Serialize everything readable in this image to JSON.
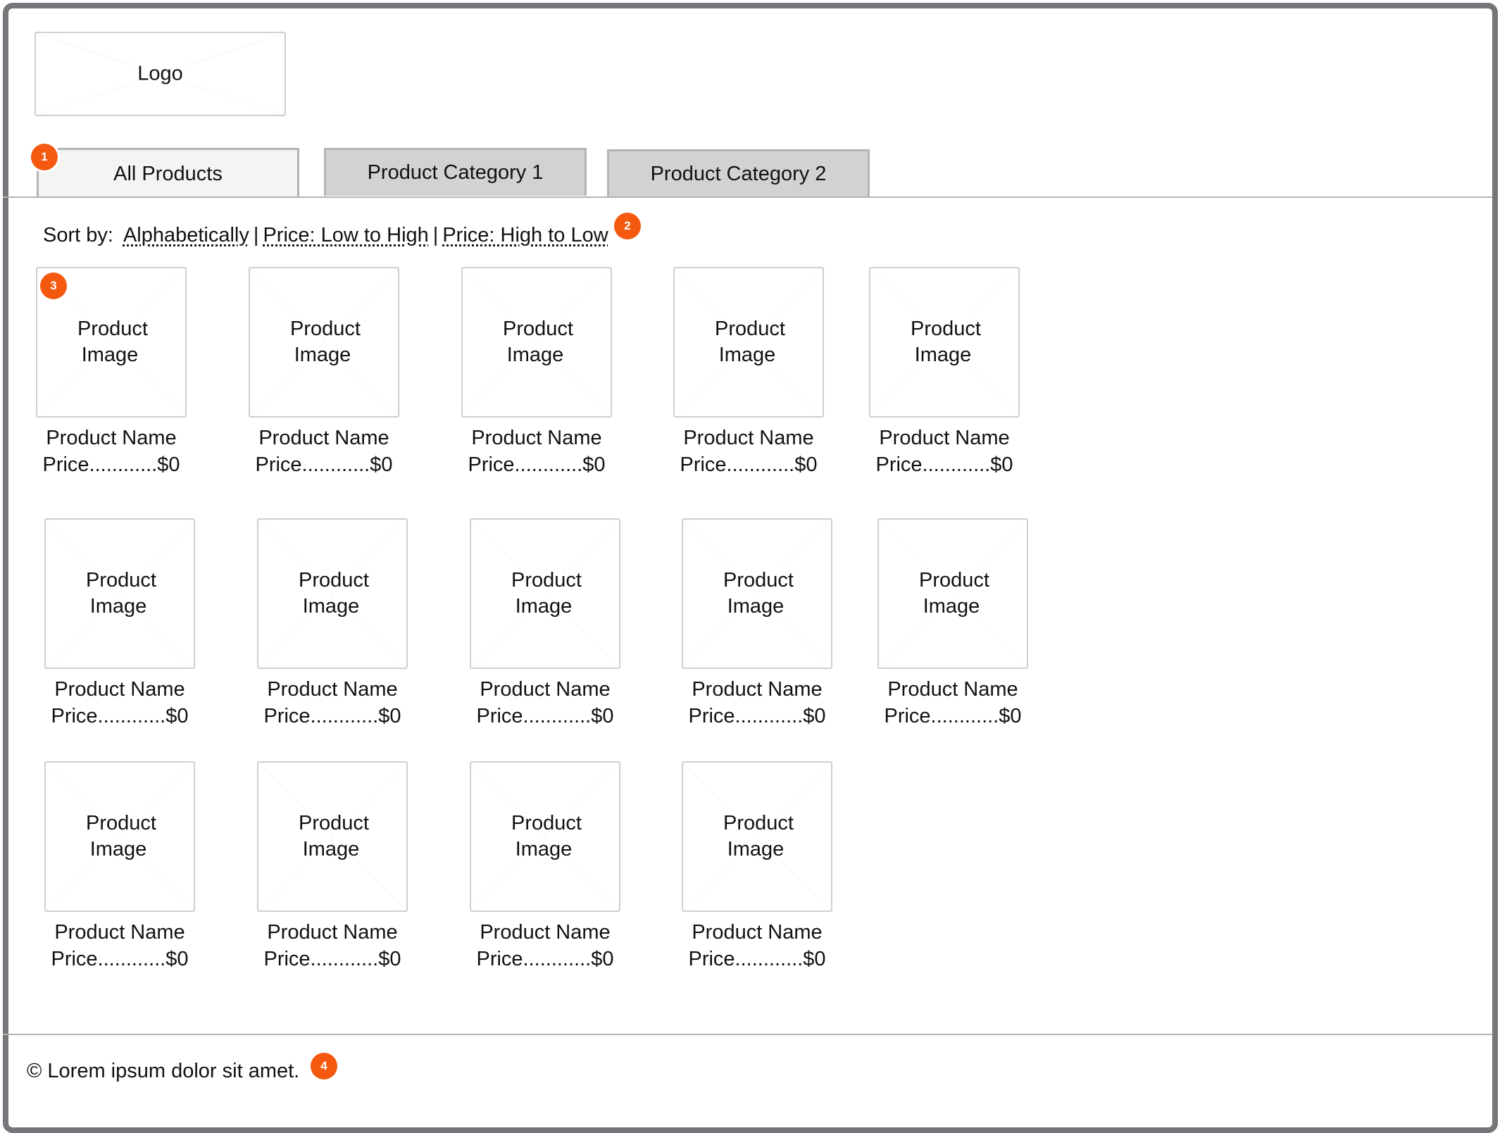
{
  "header": {
    "logo_label": "Logo"
  },
  "tabs": [
    {
      "label": "All Products",
      "active": true
    },
    {
      "label": "Product Category 1",
      "active": false
    },
    {
      "label": "Product Category 2",
      "active": false
    }
  ],
  "sort": {
    "label": "Sort by:",
    "options": [
      "Alphabetically",
      "Price: Low to High",
      "Price: High to Low"
    ],
    "separator": "|"
  },
  "products": [
    {
      "image_label_1": "Product",
      "image_label_2": "Image",
      "name": "Product Name",
      "price": "Price............$0"
    },
    {
      "image_label_1": "Product",
      "image_label_2": "Image",
      "name": "Product Name",
      "price": "Price............$0"
    },
    {
      "image_label_1": "Product",
      "image_label_2": "Image",
      "name": "Product Name",
      "price": "Price............$0"
    },
    {
      "image_label_1": "Product",
      "image_label_2": "Image",
      "name": "Product Name",
      "price": "Price............$0"
    },
    {
      "image_label_1": "Product",
      "image_label_2": "Image",
      "name": "Product Name",
      "price": "Price............$0"
    },
    {
      "image_label_1": "Product",
      "image_label_2": "Image",
      "name": "Product Name",
      "price": "Price............$0"
    },
    {
      "image_label_1": "Product",
      "image_label_2": "Image",
      "name": "Product Name",
      "price": "Price............$0"
    },
    {
      "image_label_1": "Product",
      "image_label_2": "Image",
      "name": "Product Name",
      "price": "Price............$0"
    },
    {
      "image_label_1": "Product",
      "image_label_2": "Image",
      "name": "Product Name",
      "price": "Price............$0"
    },
    {
      "image_label_1": "Product",
      "image_label_2": "Image",
      "name": "Product Name",
      "price": "Price............$0"
    },
    {
      "image_label_1": "Product",
      "image_label_2": "Image",
      "name": "Product Name",
      "price": "Price............$0"
    },
    {
      "image_label_1": "Product",
      "image_label_2": "Image",
      "name": "Product Name",
      "price": "Price............$0"
    },
    {
      "image_label_1": "Product",
      "image_label_2": "Image",
      "name": "Product Name",
      "price": "Price............$0"
    },
    {
      "image_label_1": "Product",
      "image_label_2": "Image",
      "name": "Product Name",
      "price": "Price............$0"
    }
  ],
  "annotations": [
    "1",
    "2",
    "3",
    "4"
  ],
  "footer": {
    "text": "© Lorem ipsum dolor sit amet."
  },
  "colors": {
    "badge": "#f4590f",
    "frame": "#76767a",
    "tab_inactive": "#d2d2d2",
    "tab_active": "#f4f4f3"
  }
}
